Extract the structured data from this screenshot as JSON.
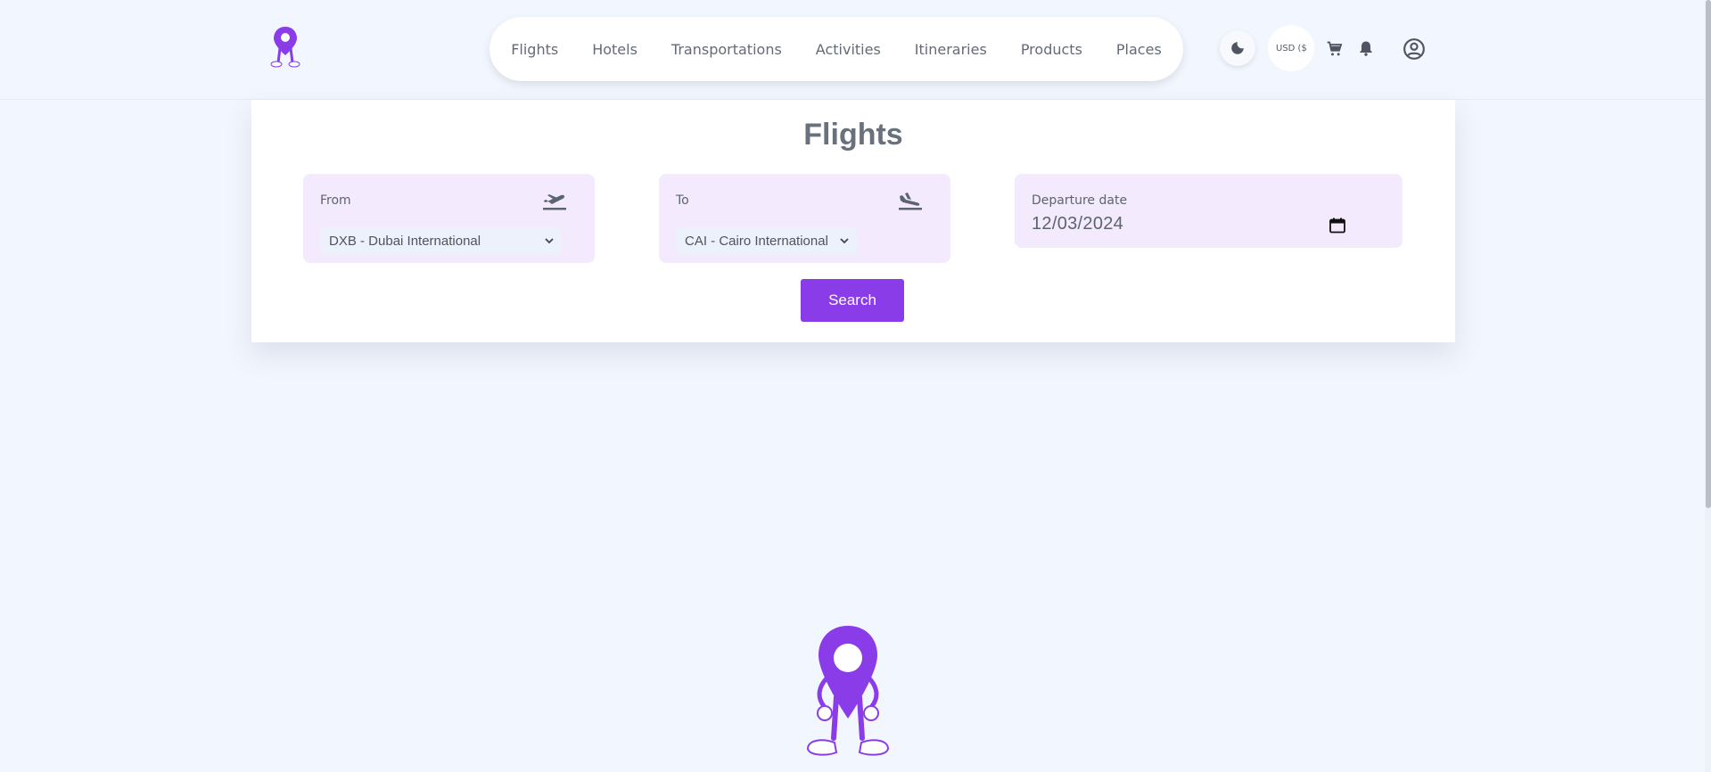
{
  "nav": {
    "items": [
      {
        "label": "Flights"
      },
      {
        "label": "Hotels"
      },
      {
        "label": "Transportations"
      },
      {
        "label": "Activities"
      },
      {
        "label": "Itineraries"
      },
      {
        "label": "Products"
      },
      {
        "label": "Places"
      }
    ]
  },
  "header": {
    "currency_label": "USD ($",
    "icons": [
      "moon-icon",
      "cart-icon",
      "bell-icon",
      "user-circle-icon"
    ]
  },
  "search_card": {
    "title": "Flights",
    "from": {
      "label": "From",
      "value": "DXB - Dubai International",
      "icon": "airplane-takeoff-icon"
    },
    "to": {
      "label": "To",
      "value": "CAI - Cairo International",
      "icon": "airplane-landing-icon"
    },
    "departure": {
      "label": "Departure date",
      "value": "12/03/2024",
      "icon": "calendar-icon"
    },
    "search_label": "Search"
  },
  "colors": {
    "accent": "#8a3ce8",
    "background": "#f2f6fe",
    "field_bg": "#f3eafd"
  }
}
